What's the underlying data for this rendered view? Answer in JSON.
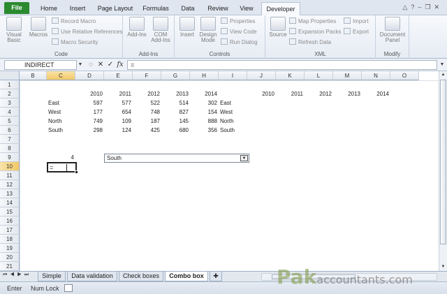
{
  "ribbon_tabs": [
    "File",
    "Home",
    "Insert",
    "Page Layout",
    "Formulas",
    "Data",
    "Review",
    "View",
    "Developer"
  ],
  "active_tab": "Developer",
  "ribbon": {
    "code": {
      "label": "Code",
      "visual_basic": "Visual Basic",
      "macros": "Macros",
      "record_macro": "Record Macro",
      "use_relative": "Use Relative References",
      "macro_security": "Macro Security"
    },
    "addins": {
      "label": "Add-Ins",
      "add_ins": "Add-Ins",
      "com_add_ins": "COM Add-Ins"
    },
    "controls": {
      "label": "Controls",
      "insert": "Insert",
      "design_mode": "Design Mode",
      "properties": "Properties",
      "view_code": "View Code",
      "run_dialog": "Run Dialog"
    },
    "xml": {
      "label": "XML",
      "source": "Source",
      "map_properties": "Map Properties",
      "expansion_packs": "Expansion Packs",
      "refresh_data": "Refresh Data",
      "import": "Import",
      "export": "Export"
    },
    "modify": {
      "label": "Modify",
      "document_panel": "Document Panel"
    }
  },
  "formula_bar": {
    "name_box": "INDIRECT",
    "formula": "=",
    "fx": "fx"
  },
  "columns": [
    "B",
    "C",
    "D",
    "E",
    "F",
    "G",
    "H",
    "I",
    "J",
    "K",
    "L",
    "M",
    "N",
    "O"
  ],
  "rows": [
    "1",
    "2",
    "3",
    "4",
    "5",
    "6",
    "7",
    "8",
    "9",
    "10",
    "11",
    "12",
    "13",
    "14",
    "15",
    "16",
    "17",
    "18",
    "19",
    "20",
    "21"
  ],
  "table": {
    "years": [
      "2010",
      "2011",
      "2012",
      "2013",
      "2014"
    ],
    "data": [
      {
        "region": "East",
        "values": [
          "597",
          "577",
          "522",
          "514",
          "302"
        ]
      },
      {
        "region": "West",
        "values": [
          "177",
          "654",
          "748",
          "827",
          "154"
        ]
      },
      {
        "region": "North",
        "values": [
          "749",
          "109",
          "187",
          "145",
          "888"
        ]
      },
      {
        "region": "South",
        "values": [
          "298",
          "124",
          "425",
          "680",
          "356"
        ]
      }
    ]
  },
  "list_regions": [
    "East",
    "West",
    "North",
    "South"
  ],
  "right_years": [
    "2010",
    "2011",
    "2012",
    "2013",
    "2014"
  ],
  "c9_value": "4",
  "active_cell_content": "=",
  "combo_box": {
    "selected": "South"
  },
  "sheet_tabs": [
    "Simple",
    "Data validation",
    "Check boxes",
    "Combo box"
  ],
  "active_sheet": "Combo box",
  "status": {
    "mode": "Enter",
    "num_lock": "Num Lock"
  },
  "watermark": {
    "brand": "Pak",
    "suffix": "accountants.com"
  },
  "colors": {
    "file_tab": "#2b8a2f",
    "selection": "#f2c867"
  }
}
